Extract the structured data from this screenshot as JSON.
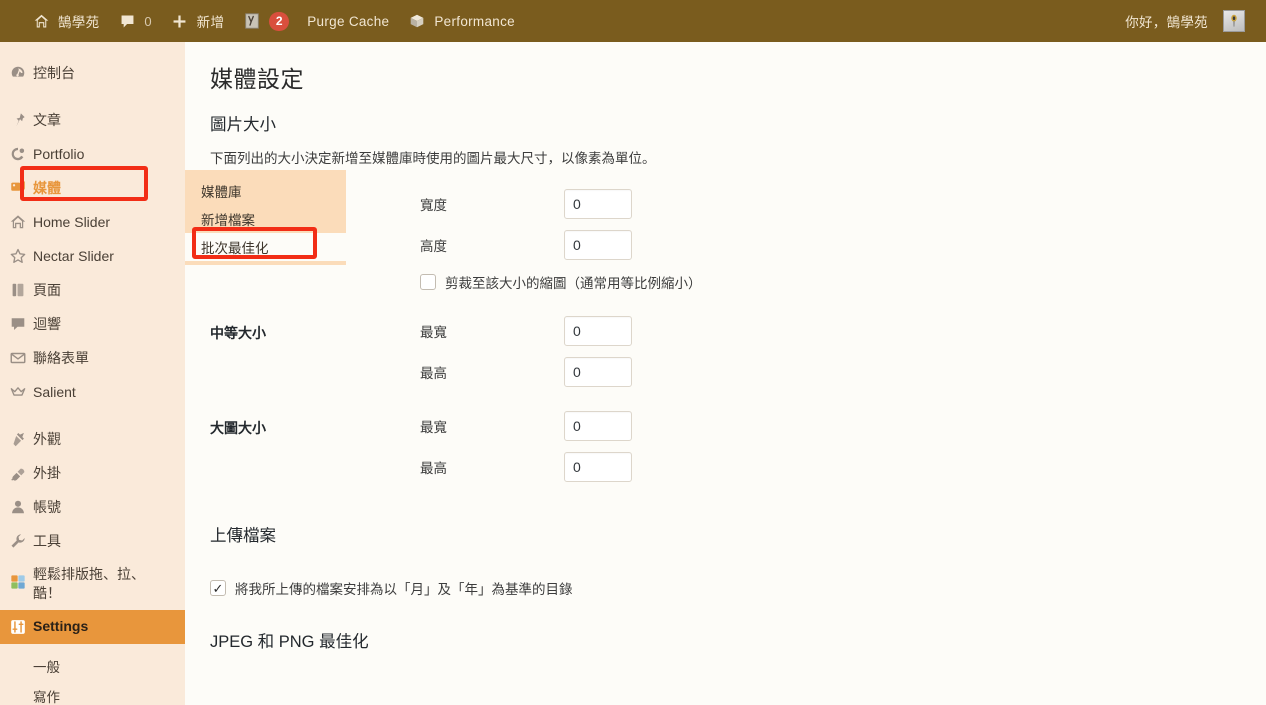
{
  "adminbar": {
    "items": [
      {
        "icon": "home-icon",
        "label": "鵠學苑",
        "count": ""
      },
      {
        "icon": "comment-icon",
        "label": "",
        "count": "0"
      },
      {
        "icon": "plus-icon",
        "label": "新增",
        "count": ""
      },
      {
        "icon": "yoast-seo-icon",
        "label": "",
        "badge": "2"
      },
      {
        "icon": "",
        "label": "Purge Cache",
        "count": ""
      },
      {
        "icon": "performance-cube-icon",
        "label": "Performance",
        "count": ""
      }
    ],
    "greeting": "你好，鵠學苑",
    "avatar": "avatar"
  },
  "sidebar": {
    "items": [
      {
        "icon": "dashboard-icon",
        "label": "控制台",
        "state": "normal",
        "gap_after": true
      },
      {
        "icon": "pin-icon",
        "label": "文章",
        "state": "normal"
      },
      {
        "icon": "portfolio-icon",
        "label": "Portfolio",
        "state": "normal"
      },
      {
        "icon": "media-icon",
        "label": "媒體",
        "state": "media-highlight"
      },
      {
        "icon": "home-slider-icon",
        "label": "Home Slider",
        "state": "normal"
      },
      {
        "icon": "star-icon",
        "label": "Nectar Slider",
        "state": "normal"
      },
      {
        "icon": "pages-icon",
        "label": "頁面",
        "state": "normal"
      },
      {
        "icon": "comment-icon",
        "label": "迴響",
        "state": "normal"
      },
      {
        "icon": "mail-icon",
        "label": "聯絡表單",
        "state": "normal"
      },
      {
        "icon": "crown-icon",
        "label": "Salient",
        "state": "normal",
        "gap_after": true
      },
      {
        "icon": "appearance-brush-icon",
        "label": "外觀",
        "state": "normal"
      },
      {
        "icon": "plugins-plug-icon",
        "label": "外掛",
        "state": "normal"
      },
      {
        "icon": "users-icon",
        "label": "帳號",
        "state": "normal"
      },
      {
        "icon": "tools-wrench-icon",
        "label": "工具",
        "state": "normal"
      },
      {
        "icon": "puzzle-icon",
        "label": "輕鬆排版拖、拉、酷！",
        "state": "normal",
        "multiline": true
      },
      {
        "icon": "settings-sliders-icon",
        "label": "Settings",
        "state": "current"
      }
    ],
    "settings_submenu": [
      {
        "label": "一般"
      },
      {
        "label": "寫作"
      }
    ]
  },
  "flyout": {
    "items": [
      {
        "label": "媒體庫",
        "highlighted": false
      },
      {
        "label": "新增檔案",
        "highlighted": false
      },
      {
        "label": "批次最佳化",
        "highlighted": true
      }
    ]
  },
  "main": {
    "page_title": "媒體設定",
    "image_sizes": {
      "heading": "圖片大小",
      "description": "下面列出的大小決定新增至媒體庫時使用的圖片最大尺寸，以像素為單位。",
      "rows": [
        {
          "label": "",
          "fields": [
            {
              "label": "寬度",
              "value": "0"
            },
            {
              "label": "高度",
              "value": "0"
            }
          ],
          "checkbox": {
            "label": "剪裁至該大小的縮圖（通常用等比例縮小）",
            "checked": false
          }
        },
        {
          "label": "中等大小",
          "fields": [
            {
              "label": "最寬",
              "value": "0"
            },
            {
              "label": "最高",
              "value": "0"
            }
          ]
        },
        {
          "label": "大圖大小",
          "fields": [
            {
              "label": "最寬",
              "value": "0"
            },
            {
              "label": "最高",
              "value": "0"
            }
          ]
        }
      ]
    },
    "uploads": {
      "heading": "上傳檔案",
      "checkbox": {
        "label": "將我所上傳的檔案安排為以「月」及「年」為基準的目錄",
        "checked": true
      }
    },
    "jpeg_png": {
      "heading": "JPEG 和 PNG 最佳化"
    }
  },
  "colors": {
    "adminbar_bg": "#7a5c1e",
    "sidebar_bg": "#faeada",
    "current_item_bg": "#e8963c",
    "flyout_bg": "#fbdcba",
    "annotation_red": "#f22d16",
    "content_bg": "#fdfcf8",
    "badge_red": "#d94f3d"
  }
}
